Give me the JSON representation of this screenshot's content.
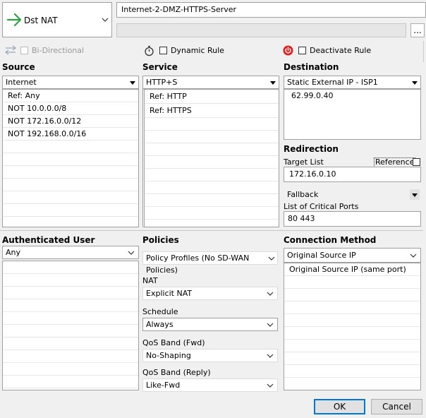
{
  "header": {
    "rule_type": "Dst NAT",
    "rule_name": "Internet-2-DMZ-HTTPS-Server",
    "comment": "",
    "more_label": "...",
    "bidirectional_label": "Bi-Directional",
    "dynamic_rule_label": "Dynamic Rule",
    "deactivate_rule_label": "Deactivate Rule"
  },
  "source": {
    "title": "Source",
    "selected": "Internet",
    "items": [
      "Ref: Any",
      "NOT 10.0.0.0/8",
      "NOT 172.16.0.0/12",
      "NOT 192.168.0.0/16"
    ]
  },
  "service": {
    "title": "Service",
    "selected": "HTTP+S",
    "items": [
      "Ref: HTTP",
      "Ref: HTTPS"
    ]
  },
  "destination": {
    "title": "Destination",
    "selected": "Static External IP - ISP1",
    "items": [
      "62.99.0.40"
    ]
  },
  "redirection": {
    "title": "Redirection",
    "target_list_label": "Target List",
    "reference_label": "Reference",
    "target_value": "172.16.0.10",
    "fallback": "Fallback",
    "critical_ports_label": "List of Critical Ports",
    "critical_ports_value": "80 443"
  },
  "auth_user": {
    "title": "Authenticated User",
    "selected": "Any"
  },
  "policies": {
    "title": "Policies",
    "profile": "Policy Profiles (No SD-WAN Policies)",
    "nat_label": "NAT",
    "nat_value": "Explicit NAT",
    "schedule_label": "Schedule",
    "schedule_value": "Always",
    "qos_fwd_label": "QoS Band (Fwd)",
    "qos_fwd_value": "No-Shaping",
    "qos_reply_label": "QoS Band (Reply)",
    "qos_reply_value": "Like-Fwd"
  },
  "connection": {
    "title": "Connection Method",
    "selected": "Original Source IP",
    "items": [
      "Original Source IP (same port)"
    ]
  },
  "footer": {
    "ok_label": "OK",
    "cancel_label": "Cancel"
  },
  "colors": {
    "accent_green": "#2ea043",
    "deactivate_red": "#e02020",
    "default_button_border": "#0078d7"
  }
}
